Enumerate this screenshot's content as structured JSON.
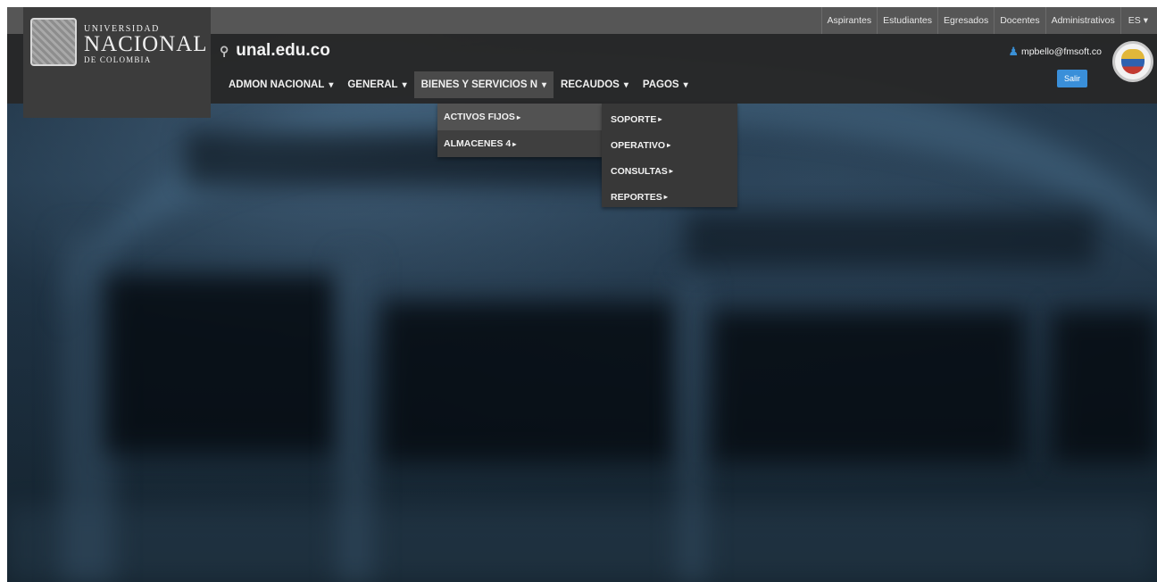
{
  "topbar": {
    "links": [
      "Aspirantes",
      "Estudiantes",
      "Egresados",
      "Docentes",
      "Administrativos"
    ],
    "language": "ES"
  },
  "logo": {
    "line1": "UNIVERSIDAD",
    "line2": "NACIONAL",
    "line3": "DE COLOMBIA"
  },
  "domain": "unal.edu.co",
  "nav": {
    "items": [
      {
        "label": "ADMON NACIONAL"
      },
      {
        "label": "GENERAL"
      },
      {
        "label": "BIENES Y SERVICIOS N"
      },
      {
        "label": "RECAUDOS"
      },
      {
        "label": "PAGOS"
      }
    ],
    "caret": "▾"
  },
  "user": {
    "email": "mpbello@fmsoft.co",
    "logout_label": "Salir"
  },
  "dropdown_bienes": {
    "items": [
      "ACTIVOS FIJOS",
      "ALMACENES 4"
    ]
  },
  "dropdown_activos": {
    "items": [
      "SOPORTE",
      "OPERATIVO",
      "CONSULTAS",
      "REPORTES"
    ]
  },
  "submenu_arrow": "▸",
  "colors": {
    "topbar": "#565656",
    "header": "#282828",
    "dropdown": "#3f3f3f",
    "accent": "#3a8fd9"
  }
}
